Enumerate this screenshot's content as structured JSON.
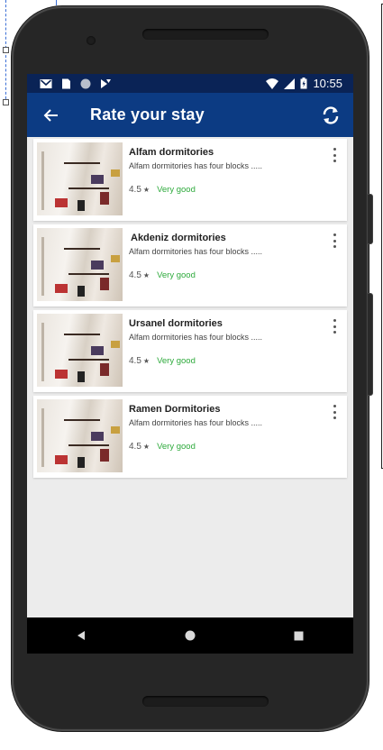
{
  "status_bar": {
    "time": "10:55",
    "icons": [
      "gmail-icon",
      "sim-icon",
      "circle-icon",
      "download-icon",
      "wifi-icon",
      "signal-icon",
      "battery-icon"
    ]
  },
  "app_bar": {
    "title": "Rate your stay",
    "back_icon": "arrow-left-icon",
    "refresh_icon": "refresh-icon",
    "color": "#0c3b83"
  },
  "dorms": [
    {
      "name": "Alfam dormitories",
      "description": "Alfam dormitories has four blocks .....",
      "rating": "4.5",
      "rating_label": "Very good"
    },
    {
      "name": "Akdeniz dormitories",
      "description": "Alfam dormitories has four blocks .....",
      "rating": "4.5",
      "rating_label": "Very good"
    },
    {
      "name": "Ursanel dormitories",
      "description": "Alfam dormitories has four blocks .....",
      "rating": "4.5",
      "rating_label": "Very good"
    },
    {
      "name": "Ramen Dormitories",
      "description": "Alfam dormitories has four blocks .....",
      "rating": "4.5",
      "rating_label": "Very good"
    }
  ],
  "nav_bar": {
    "icons": [
      "back-triangle-icon",
      "home-circle-icon",
      "recents-square-icon"
    ]
  }
}
